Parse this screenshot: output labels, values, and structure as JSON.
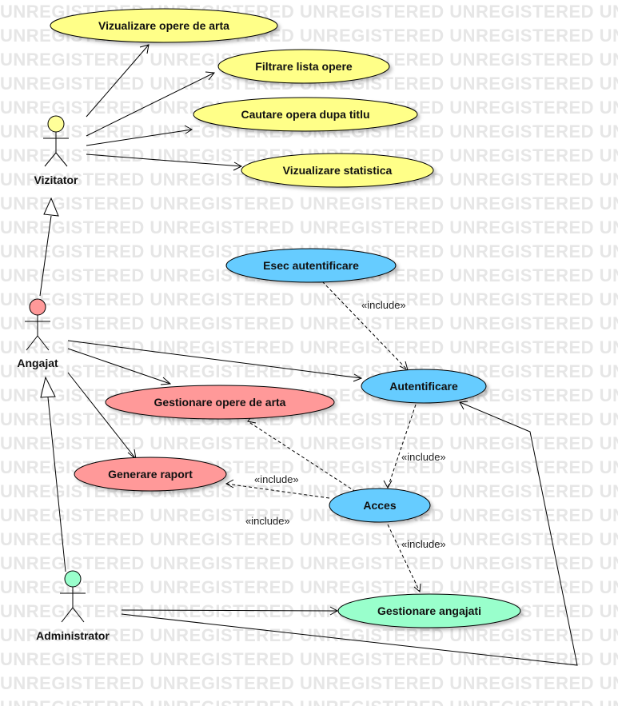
{
  "watermark": "UNREGISTERED",
  "actors": {
    "vizitator": {
      "label": "Vizitator",
      "color": "#ffff99"
    },
    "angajat": {
      "label": "Angajat",
      "color": "#ff9999"
    },
    "administrator": {
      "label": "Administrator",
      "color": "#99ffcc"
    }
  },
  "use_cases": {
    "vizualizare_opere": "Vizualizare opere de arta",
    "filtrare_lista": "Filtrare lista opere",
    "cautare_opera": "Cautare opera dupa titlu",
    "vizualizare_statistica": "Vizualizare statistica",
    "esec_autentificare": "Esec autentificare",
    "autentificare": "Autentificare",
    "gestionare_opere": "Gestionare opere de arta",
    "generare_raport": "Generare raport",
    "acces": "Acces",
    "gestionare_angajati": "Gestionare angajati"
  },
  "relations": {
    "esec_to_autentificare": "«include»",
    "autentificare_to_acces": "«include»",
    "acces_to_raport": "«include»",
    "acces_to_opere": "«include»",
    "acces_to_angajati": "«include»"
  },
  "colors": {
    "visitor_uc": "#ffff88",
    "employee_uc": "#ff9999",
    "auth_uc": "#66ccff",
    "admin_uc": "#99ffcc"
  }
}
